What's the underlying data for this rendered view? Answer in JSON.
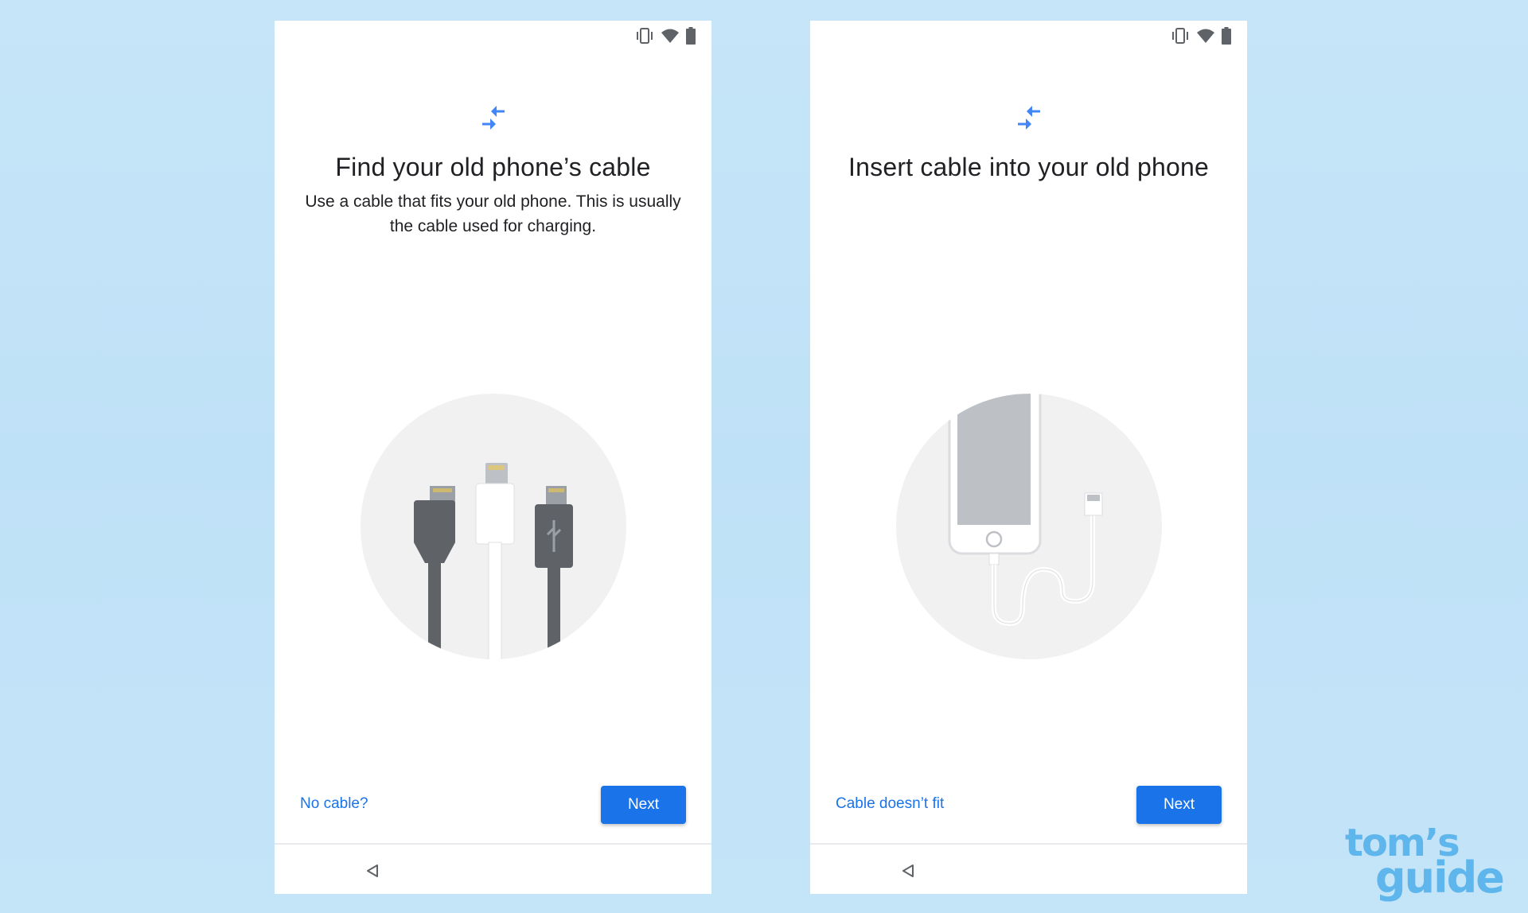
{
  "screens": [
    {
      "title": "Find your old phone’s cable",
      "subtitle": "Use a cable that fits your old phone. This is usually the cable used for charging.",
      "secondary_action": "No cable?",
      "primary_action": "Next",
      "illustration": "three-charging-cables"
    },
    {
      "title": "Insert cable into your old phone",
      "subtitle": "",
      "secondary_action": "Cable doesn’t fit",
      "primary_action": "Next",
      "illustration": "iphone-with-cable"
    }
  ],
  "status_icons": [
    "vibrate-icon",
    "wifi-icon",
    "battery-icon"
  ],
  "nav_icons": [
    "back-icon"
  ],
  "watermark": {
    "line1": "tom’s",
    "line2": "guide"
  },
  "colors": {
    "accent": "#1a73e8",
    "background": "#c6e5f8",
    "illustration_circle": "#f1f1f2",
    "watermark": "#5fb6ec"
  }
}
